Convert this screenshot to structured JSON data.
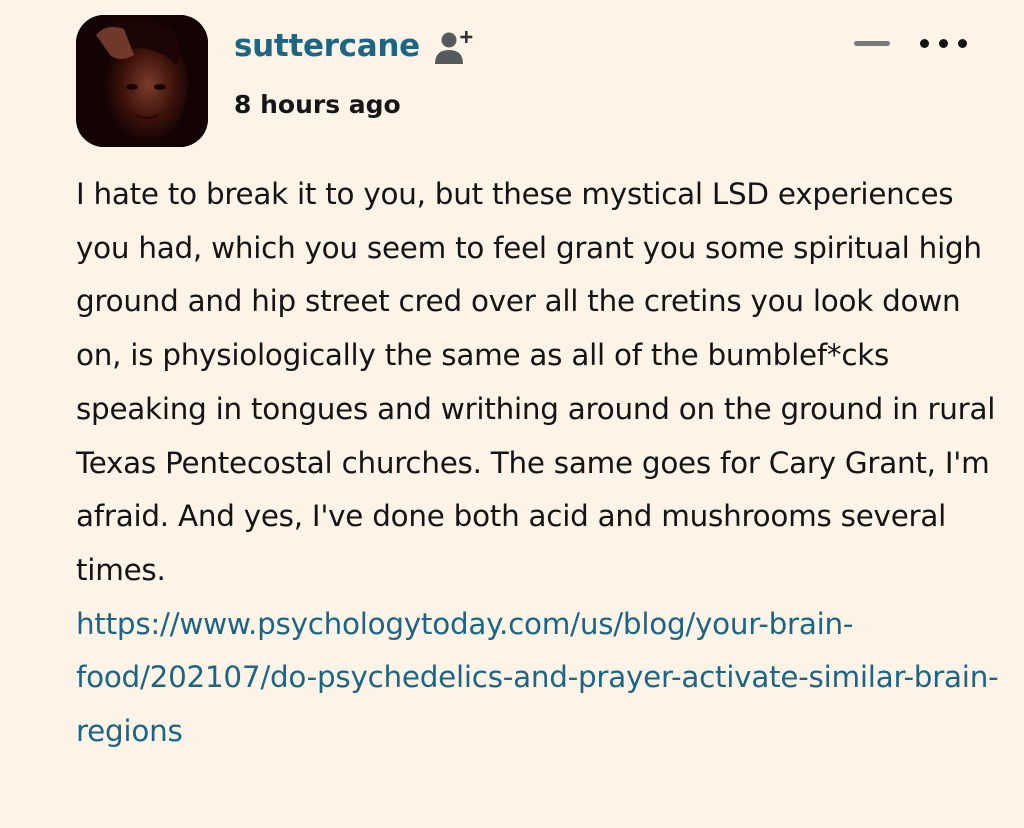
{
  "comment": {
    "username": "suttercane",
    "timestamp": "8 hours ago",
    "body": "I hate to break it to you, but these mystical LSD experiences you had, which you seem to feel grant you some spiritual high ground and hip street cred over all the cretins you look down on, is physiologically the same as all of the bumblef*cks speaking in tongues and writhing around on the ground in rural Texas Pentecostal churches. The same goes for Cary Grant, I'm afraid. And yes, I've done both acid and mushrooms several times.",
    "link": "https://www.psychologytoday.com/us/blog/your-brain-food/202107/do-psychedelics-and-prayer-activate-similar-brain-regions",
    "icons": {
      "follow": "add-user-icon",
      "collapse": "minus-icon",
      "more": "more-dots-icon"
    }
  },
  "colors": {
    "background": "#fdf3e7",
    "username": "#1d6585",
    "link": "#1d6585",
    "text": "#141414",
    "icon_gray": "#7b7b7b"
  }
}
